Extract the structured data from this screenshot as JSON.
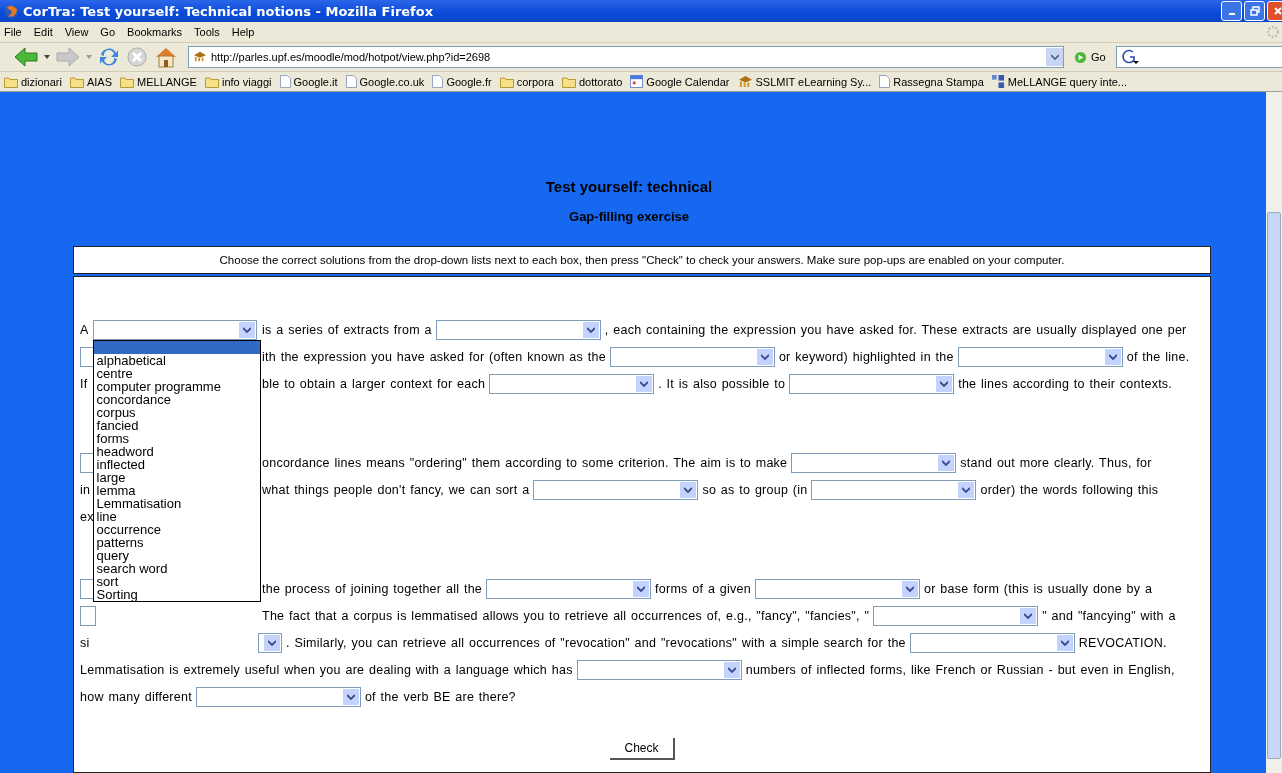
{
  "window": {
    "title": "CorTra: Test yourself: Technical notions - Mozilla Firefox"
  },
  "menu": [
    "File",
    "Edit",
    "View",
    "Go",
    "Bookmarks",
    "Tools",
    "Help"
  ],
  "address": {
    "url": "http://parles.upf.es/moodle/mod/hotpot/view.php?id=2698",
    "go": "Go"
  },
  "bookmarks": [
    {
      "kind": "folder",
      "label": "dizionari"
    },
    {
      "kind": "folder",
      "label": "AIAS"
    },
    {
      "kind": "folder",
      "label": "MELLANGE"
    },
    {
      "kind": "folder",
      "label": "info viaggi"
    },
    {
      "kind": "page",
      "label": "Google.it"
    },
    {
      "kind": "page",
      "label": "Google.co.uk"
    },
    {
      "kind": "page",
      "label": "Google.fr"
    },
    {
      "kind": "folder",
      "label": "corpora"
    },
    {
      "kind": "folder",
      "label": "dottorato"
    },
    {
      "kind": "calendar",
      "label": "Google Calendar"
    },
    {
      "kind": "moodle",
      "label": "SSLMIT eLearning Sy..."
    },
    {
      "kind": "page",
      "label": "Rassegna Stampa"
    },
    {
      "kind": "squares",
      "label": "MeLLANGE query inte..."
    }
  ],
  "page": {
    "title": "Test yourself: technical",
    "subtitle": "Gap-filling exercise",
    "instructions": "Choose the correct solutions from the drop-down lists next to each box, then press \"Check\" to check your answers. Make sure pop-ups are enabled on your computer.",
    "paragraphs": [
      [
        {
          "lead": [
            {
              "kind": "text",
              "text": "A"
            },
            {
              "kind": "select",
              "open": true
            }
          ],
          "rest": [
            {
              "kind": "text",
              "text": "is a series of extracts from a"
            },
            {
              "kind": "select"
            },
            {
              "kind": "text",
              "text": ", each containing the expression you have asked for. These extracts are usually displayed one per"
            }
          ]
        },
        {
          "lead": [
            {
              "kind": "select"
            }
          ],
          "rest": [
            {
              "kind": "text",
              "text": "ith the expression you have asked for (often known as the"
            },
            {
              "kind": "select"
            },
            {
              "kind": "text",
              "text": "or keyword) highlighted in the"
            },
            {
              "kind": "select"
            },
            {
              "kind": "text",
              "text": "of the line."
            }
          ]
        },
        {
          "lead": [
            {
              "kind": "text",
              "text": "If"
            }
          ],
          "rest": [
            {
              "kind": "text",
              "text": "ble to obtain a larger context for each"
            },
            {
              "kind": "select"
            },
            {
              "kind": "text",
              "text": ". It is also possible to"
            },
            {
              "kind": "select"
            },
            {
              "kind": "text",
              "text": "the lines according to their contexts."
            }
          ]
        }
      ],
      [
        {
          "lead": [
            {
              "kind": "select"
            }
          ],
          "rest": [
            {
              "kind": "text",
              "text": "oncordance lines means \"ordering\" them according to some criterion. The aim is to make"
            },
            {
              "kind": "select"
            },
            {
              "kind": "text",
              "text": "stand out more clearly. Thus, for"
            }
          ]
        },
        {
          "lead": [
            {
              "kind": "text",
              "text": "in"
            }
          ],
          "rest": [
            {
              "kind": "text",
              "text": "what things people don't fancy, we can sort a"
            },
            {
              "kind": "select"
            },
            {
              "kind": "text",
              "text": "so as to group (in"
            },
            {
              "kind": "select"
            },
            {
              "kind": "text",
              "text": "order) the words following this"
            }
          ]
        },
        {
          "lead": [
            {
              "kind": "text",
              "text": "ex"
            }
          ]
        }
      ],
      [
        {
          "lead": [
            {
              "kind": "select"
            }
          ],
          "rest": [
            {
              "kind": "text",
              "text": "the process of joining together all the"
            },
            {
              "kind": "select"
            },
            {
              "kind": "text",
              "text": "forms of a given"
            },
            {
              "kind": "select"
            },
            {
              "kind": "text",
              "text": "or base form (this is usually done by a"
            }
          ]
        },
        {
          "lead": [
            {
              "kind": "select"
            }
          ],
          "rest": [
            {
              "kind": "text",
              "text": "The fact that a corpus is lemmatised allows you to retrieve all occurrences of, e.g., \"fancy\", \"fancies\", \""
            },
            {
              "kind": "select"
            },
            {
              "kind": "text",
              "text": "\" and \"fancying\" with a"
            }
          ]
        },
        {
          "lead": [
            {
              "kind": "text",
              "text": "si"
            }
          ],
          "rest": [
            {
              "kind": "select",
              "stub": true
            },
            {
              "kind": "text",
              "text": ". Similarly, you can retrieve all occurrences of \"revocation\" and \"revocations\" with a simple search for the"
            },
            {
              "kind": "select"
            },
            {
              "kind": "text",
              "text": "REVOCATION."
            }
          ]
        },
        {
          "lead": [
            {
              "kind": "text",
              "text": "Lemmatisation is extremely useful when you are dealing with a language which has"
            },
            {
              "kind": "select"
            },
            {
              "kind": "text",
              "text": "numbers of inflected forms, like French or Russian - but even in English,"
            }
          ]
        },
        {
          "lead": [
            {
              "kind": "text",
              "text": "how many different"
            },
            {
              "kind": "select"
            },
            {
              "kind": "text",
              "text": "of the verb BE are there?"
            }
          ]
        }
      ]
    ],
    "dropdown": [
      {
        "selected": true
      },
      {
        "label": "alphabetical",
        "selected": false
      },
      {
        "label": "centre",
        "selected": false
      },
      {
        "label": "computer programme",
        "selected": false
      },
      {
        "label": "concordance",
        "selected": false
      },
      {
        "label": "corpus",
        "selected": false
      },
      {
        "label": "fancied",
        "selected": false
      },
      {
        "label": "forms",
        "selected": false
      },
      {
        "label": "headword",
        "selected": false
      },
      {
        "label": "inflected",
        "selected": false
      },
      {
        "label": "large",
        "selected": false
      },
      {
        "label": "lemma",
        "selected": false
      },
      {
        "label": "Lemmatisation",
        "selected": false
      },
      {
        "label": "line",
        "selected": false
      },
      {
        "label": "occurrence",
        "selected": false
      },
      {
        "label": "patterns",
        "selected": false
      },
      {
        "label": "query",
        "selected": false
      },
      {
        "label": "search word",
        "selected": false
      },
      {
        "label": "sort",
        "selected": false
      },
      {
        "label": "Sorting",
        "selected": false
      }
    ],
    "check_button": "Check"
  }
}
